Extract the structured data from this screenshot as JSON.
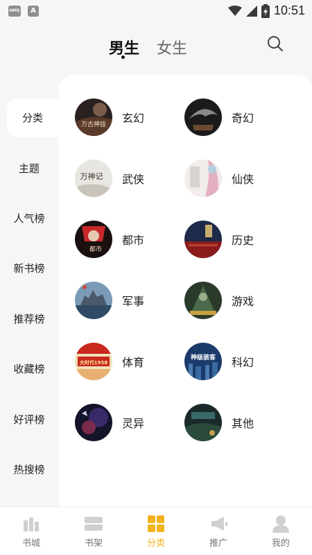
{
  "status_bar": {
    "time": "10:51",
    "left_icons": [
      "HMS",
      "A"
    ]
  },
  "header": {
    "tabs": [
      {
        "label": "男生",
        "active": true
      },
      {
        "label": "女生",
        "active": false
      }
    ],
    "search_icon": "search-icon"
  },
  "sidebar": {
    "items": [
      {
        "label": "分类",
        "active": true
      },
      {
        "label": "主题"
      },
      {
        "label": "人气榜"
      },
      {
        "label": "新书榜"
      },
      {
        "label": "推荐榜"
      },
      {
        "label": "收藏榜"
      },
      {
        "label": "好评榜"
      },
      {
        "label": "热搜榜"
      }
    ]
  },
  "categories": [
    {
      "label": "玄幻",
      "cover_text": "万古神技"
    },
    {
      "label": "奇幻",
      "cover_text": ""
    },
    {
      "label": "武侠",
      "cover_text": "万神记"
    },
    {
      "label": "仙侠",
      "cover_text": ""
    },
    {
      "label": "都市",
      "cover_text": "都市"
    },
    {
      "label": "历史",
      "cover_text": ""
    },
    {
      "label": "军事",
      "cover_text": ""
    },
    {
      "label": "游戏",
      "cover_text": ""
    },
    {
      "label": "体育",
      "cover_text": "大时代1958"
    },
    {
      "label": "科幻",
      "cover_text": "神级骇客"
    },
    {
      "label": "灵异",
      "cover_text": ""
    },
    {
      "label": "其他",
      "cover_text": ""
    }
  ],
  "bottom_nav": {
    "items": [
      {
        "label": "书城",
        "icon": "bookstore-icon"
      },
      {
        "label": "书架",
        "icon": "bookshelf-icon"
      },
      {
        "label": "分类",
        "icon": "category-grid-icon",
        "active": true
      },
      {
        "label": "推广",
        "icon": "megaphone-icon"
      },
      {
        "label": "我的",
        "icon": "user-icon"
      }
    ]
  },
  "colors": {
    "accent": "#f3b31a",
    "background": "#f6f6f6",
    "panel": "#ffffff"
  }
}
